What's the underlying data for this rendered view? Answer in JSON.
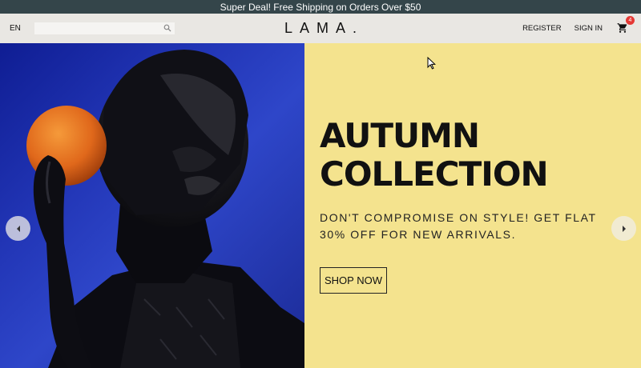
{
  "announcement": {
    "text": "Super Deal! Free Shipping on Orders Over $50"
  },
  "navbar": {
    "language": "EN",
    "search": {
      "placeholder": "",
      "value": ""
    },
    "logo": "LAMA.",
    "links": {
      "register": "REGISTER",
      "sign_in": "SIGN IN"
    },
    "cart": {
      "count": "4",
      "icon": "shopping-cart-icon"
    }
  },
  "slide": {
    "title_line1": "AUTUMN",
    "title_line2": "COLLECTION",
    "description": "DON'T COMPROMISE ON STYLE! GET FLAT 30% OFF FOR NEW ARRIVALS.",
    "button_label": "SHOP NOW",
    "background_color": "#f4e38e"
  },
  "colors": {
    "announcement_bg": "#34454a",
    "navbar_bg": "#e9e7e3",
    "badge": "#e53935",
    "image_blue": "#2337b8"
  }
}
